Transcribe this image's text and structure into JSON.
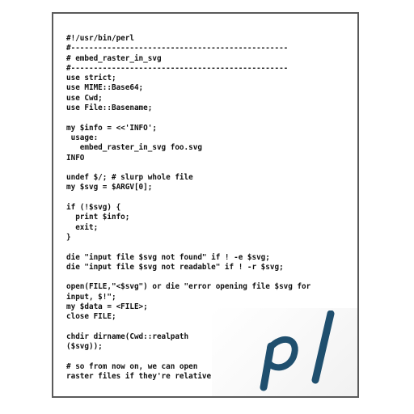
{
  "code_lines": [
    "#!/usr/bin/perl",
    "#------------------------------------------------",
    "# embed_raster_in_svg",
    "#------------------------------------------------",
    "use strict;",
    "use MIME::Base64;",
    "use Cwd;",
    "use File::Basename;",
    "",
    "my $info = <<'INFO';",
    " usage:",
    "   embed_raster_in_svg foo.svg",
    "INFO",
    "",
    "undef $/; # slurp whole file",
    "my $svg = $ARGV[0];",
    "",
    "if (!$svg) {",
    "  print $info;",
    "  exit;",
    "}",
    "",
    "die \"input file $svg not found\" if ! -e $svg;",
    "die \"input file $svg not readable\" if ! -r $svg;",
    "",
    "open(FILE,\"<$svg\") or die \"error opening file $svg for",
    "input, $!\";",
    "my $data = <FILE>;",
    "close FILE;",
    "",
    "chdir dirname(Cwd::realpath",
    "($svg));",
    "",
    "# so from now on, we can open",
    "raster files if they're relative"
  ],
  "logo": {
    "text": "pl",
    "color": "#1f4f6e"
  },
  "colors": {
    "border": "#5a5a5a",
    "text": "#111111",
    "background": "#ffffff"
  }
}
